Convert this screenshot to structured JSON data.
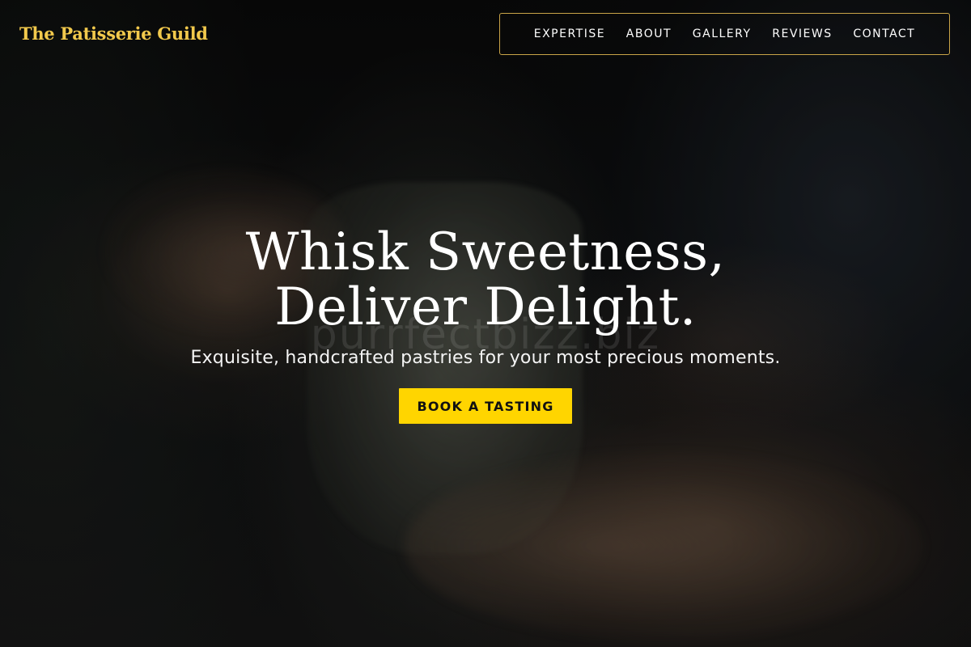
{
  "brand": {
    "name": "The Patisserie Guild",
    "color": "#f2c94c"
  },
  "nav": {
    "items": [
      {
        "label": "EXPERTISE"
      },
      {
        "label": "ABOUT"
      },
      {
        "label": "GALLERY"
      },
      {
        "label": "REVIEWS"
      },
      {
        "label": "CONTACT"
      }
    ],
    "border_color": "#c9a448"
  },
  "hero": {
    "headline_line1": "Whisk Sweetness,",
    "headline_line2": "Deliver Delight.",
    "subheadline": "Exquisite, handcrafted pastries for your most precious moments.",
    "cta_label": "BOOK A TASTING",
    "cta_color": "#ffd500",
    "watermark": "purrfectbizz.biz"
  }
}
